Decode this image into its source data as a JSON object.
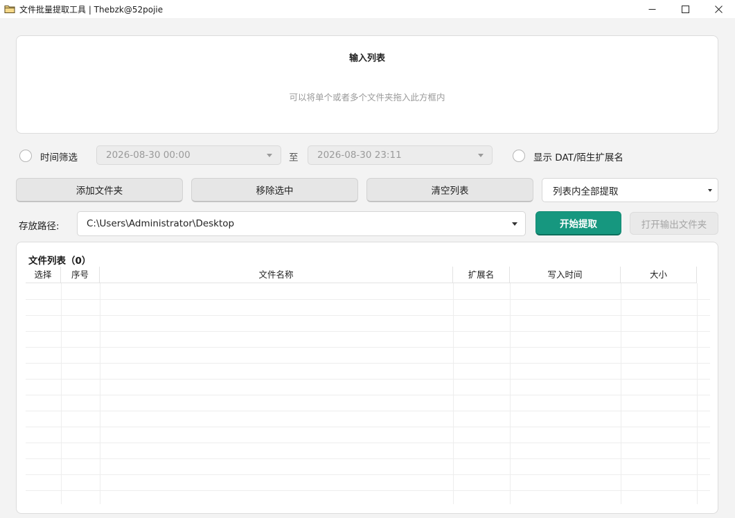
{
  "window": {
    "title": "文件批量提取工具 | Thebzk@52pojie",
    "icon": "folder-icon"
  },
  "dropzone": {
    "title": "输入列表",
    "hint": "可以将单个或者多个文件夹拖入此方框内"
  },
  "filter": {
    "time_filter_label": "时间筛选",
    "start_time": "2026-08-30 00:00",
    "to_label": "至",
    "end_time": "2026-08-30 23:11",
    "show_ext_label": "显示 DAT/陌生扩展名"
  },
  "actions": {
    "add_folder": "添加文件夹",
    "remove_selected": "移除选中",
    "clear_list": "清空列表",
    "extract_mode": "列表内全部提取"
  },
  "output": {
    "path_label": "存放路径:",
    "path_value": "C:\\Users\\Administrator\\Desktop",
    "start_button": "开始提取",
    "open_folder_button": "打开输出文件夹",
    "accent_color": "#16977f"
  },
  "file_list": {
    "title": "文件列表（0）",
    "columns": [
      "选择",
      "序号",
      "文件名称",
      "扩展名",
      "写入时间",
      "大小"
    ],
    "rows": []
  }
}
